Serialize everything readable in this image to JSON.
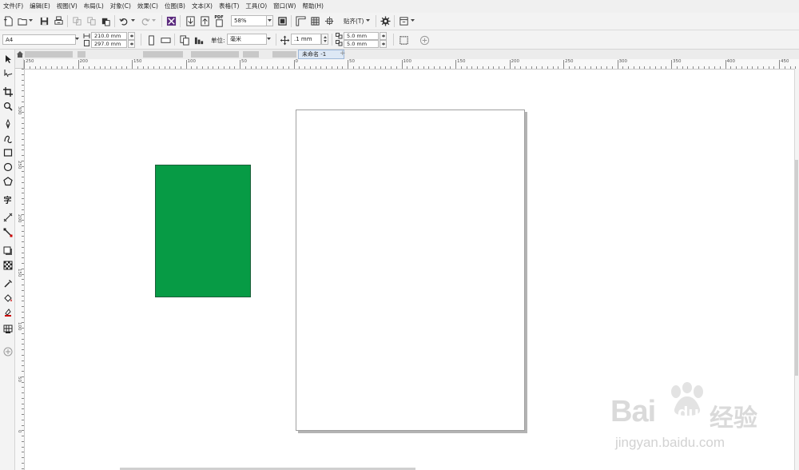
{
  "menu": [
    "文件(F)",
    "编辑(E)",
    "视图(V)",
    "布局(L)",
    "对象(C)",
    "效果(C)",
    "位图(B)",
    "文本(X)",
    "表格(T)",
    "工具(O)",
    "窗口(W)",
    "帮助(H)"
  ],
  "toolbar": {
    "pdf_label": "PDF",
    "zoom_value": "58%",
    "snap_label": "贴齐(T)"
  },
  "property_bar": {
    "page_size": "A4",
    "width": "210.0 mm",
    "height": "297.0 mm",
    "units_label": "单位:",
    "units_value": "毫米",
    "nudge": ".1 mm",
    "dup_x": "5.0 mm",
    "dup_y": "5.0 mm"
  },
  "document_tab": {
    "title": "未命名 -1",
    "add_symbol": "+"
  },
  "ruler_h_ticks": [
    "250",
    "200",
    "150",
    "100",
    "50",
    "0",
    "50",
    "100",
    "150",
    "200",
    "250",
    "300",
    "350",
    "400",
    "450"
  ],
  "ruler_v_ticks": [
    "300",
    "250",
    "200",
    "150",
    "100",
    "50",
    "0"
  ],
  "toolbox_icons": [
    "pick-tool-icon",
    "shape-tool-icon",
    "crop-tool-icon",
    "zoom-tool-icon",
    "freehand-tool-icon",
    "artistic-media-icon",
    "rectangle-tool-icon",
    "ellipse-tool-icon",
    "polygon-tool-icon",
    "text-tool-icon",
    "parallel-dimension-icon",
    "connector-tool-icon",
    "drop-shadow-icon",
    "transparency-icon",
    "eyedropper-icon",
    "interactive-fill-icon",
    "smart-fill-icon",
    "mesh-fill-icon",
    "add-tool-icon"
  ],
  "watermark": {
    "brand": "Bai",
    "brand_suffix": "du",
    "cn_text": "经验",
    "url": "jingyan.baidu.com"
  },
  "colors": {
    "object_fill": "#079b45",
    "page_shadow": "#b3b3b3"
  }
}
